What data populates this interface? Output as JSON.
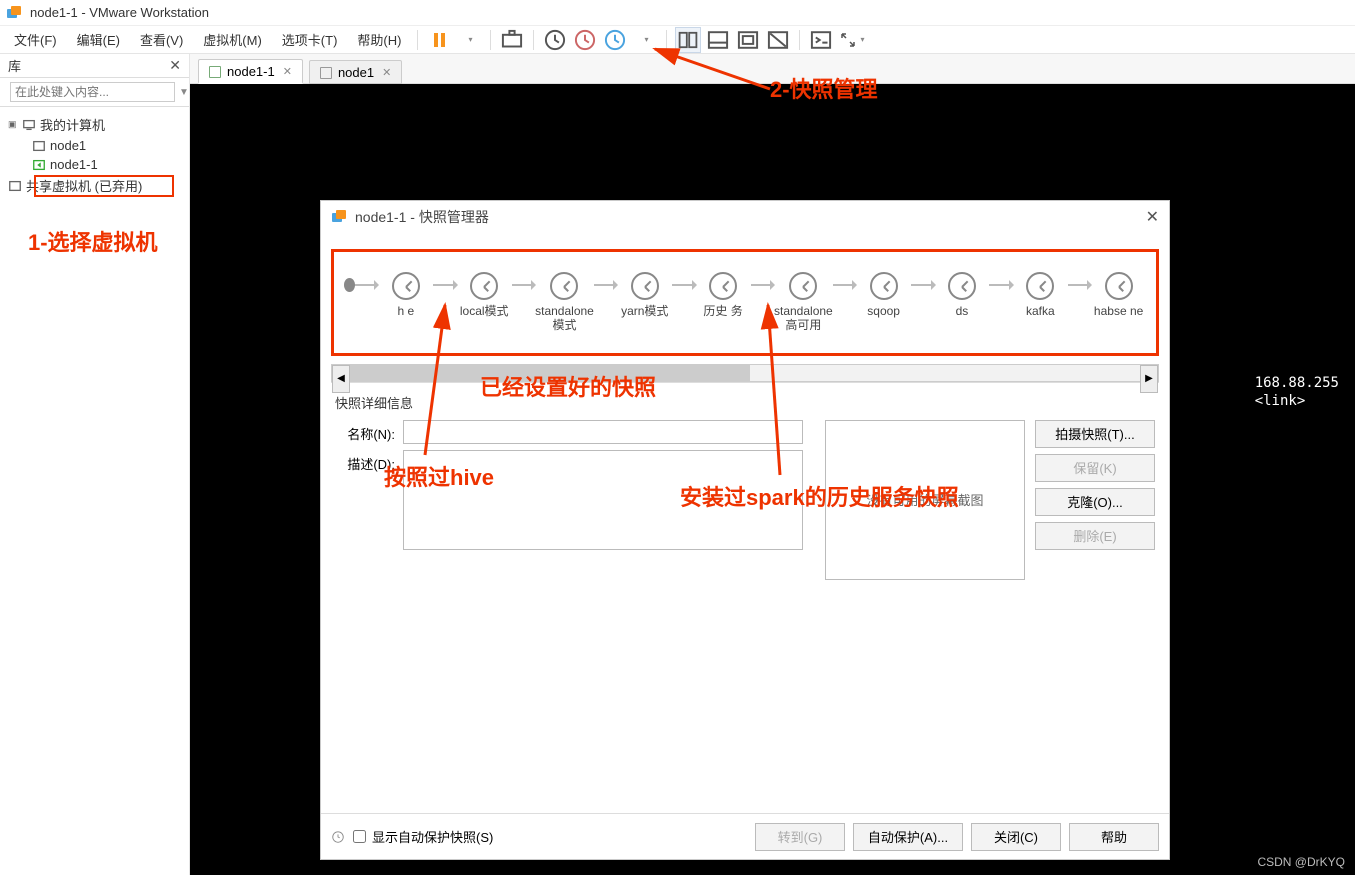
{
  "window": {
    "title": "node1-1 - VMware Workstation"
  },
  "menus": [
    "文件(F)",
    "编辑(E)",
    "查看(V)",
    "虚拟机(M)",
    "选项卡(T)",
    "帮助(H)"
  ],
  "sidebar": {
    "header": "库",
    "search_placeholder": "在此处键入内容...",
    "tree": {
      "root": "我的计算机",
      "items": [
        "node1",
        "node1-1"
      ],
      "shared": "共享虚拟机 (已弃用)"
    }
  },
  "tabs": [
    {
      "label": "node1-1",
      "active": true
    },
    {
      "label": "node1",
      "active": false
    }
  ],
  "annotations": {
    "step1": "1-选择虚拟机",
    "step2": "2-快照管理",
    "hive": "按照过hive",
    "configured": "已经设置好的快照",
    "spark": "安装过spark的历史服务快照"
  },
  "console": "168.88.255\n<link>",
  "dialog": {
    "title": "node1-1 - 快照管理器",
    "snapshots": [
      "h  e",
      "local模式",
      "standalone 模式",
      "yarn模式",
      "历史  务",
      "standalone 高可用",
      "sqoop",
      "ds",
      "kafka",
      "habse ne"
    ],
    "details_title": "快照详细信息",
    "name_label": "名称(N):",
    "desc_label": "描述(D):",
    "no_screenshot": "没有可用的屏幕截图",
    "buttons": {
      "take": "拍摄快照(T)...",
      "keep": "保留(K)",
      "clone": "克隆(O)...",
      "delete": "删除(E)"
    },
    "footer": {
      "autoprotect_label": "显示自动保护快照(S)",
      "goto": "转到(G)",
      "autoprotect": "自动保护(A)...",
      "close": "关闭(C)",
      "help": "帮助"
    }
  },
  "watermark": "CSDN @DrKYQ"
}
